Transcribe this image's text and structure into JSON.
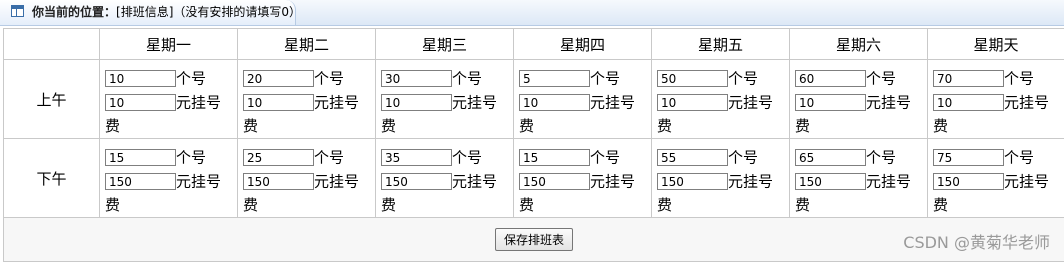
{
  "breadcrumb": {
    "label": "你当前的位置：",
    "location": "[排班信息]",
    "hint": "（没有安排的请填写0）"
  },
  "table": {
    "days": [
      "星期一",
      "星期二",
      "星期三",
      "星期四",
      "星期五",
      "星期六",
      "星期天"
    ],
    "rows": [
      {
        "label": "上午",
        "counts": [
          "10",
          "20",
          "30",
          "5",
          "50",
          "60",
          "70"
        ],
        "fees": [
          "10",
          "10",
          "10",
          "10",
          "10",
          "10",
          "10"
        ]
      },
      {
        "label": "下午",
        "counts": [
          "15",
          "25",
          "35",
          "15",
          "55",
          "65",
          "75"
        ],
        "fees": [
          "150",
          "150",
          "150",
          "150",
          "150",
          "150",
          "150"
        ]
      }
    ],
    "count_unit": "个号",
    "fee_unit_1": "元挂号",
    "fee_unit_2": "费"
  },
  "save_label": "保存排班表",
  "watermark": "CSDN @黄菊华老师"
}
